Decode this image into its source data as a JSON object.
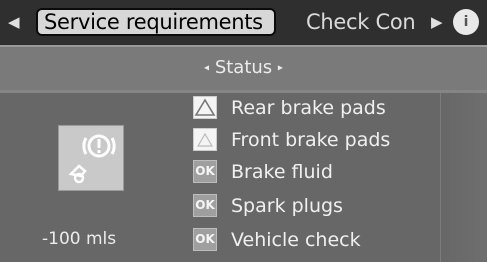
{
  "tabs": {
    "active": "Service requirements",
    "next": "Check Con",
    "info_glyph": "i"
  },
  "status": {
    "title": "Status"
  },
  "summary": {
    "remaining": "-100 mls"
  },
  "items": [
    {
      "label": "Rear brake pads",
      "state": "warning",
      "icon": "warning-triangle-icon",
      "badge": ""
    },
    {
      "label": "Front brake pads",
      "state": "warning",
      "icon": "warning-triangle-icon",
      "badge": ""
    },
    {
      "label": "Brake fluid",
      "state": "ok",
      "icon": "ok-badge-icon",
      "badge": "OK"
    },
    {
      "label": "Spark plugs",
      "state": "ok",
      "icon": "ok-badge-icon",
      "badge": "OK"
    },
    {
      "label": "Vehicle check",
      "state": "ok",
      "icon": "ok-badge-icon",
      "badge": "OK"
    }
  ],
  "colors": {
    "screen_bg": "#6b6b6b",
    "tab_bar": "#2f2f2f",
    "active_tab": "#d7d7d7",
    "text": "#f0f0f0"
  }
}
